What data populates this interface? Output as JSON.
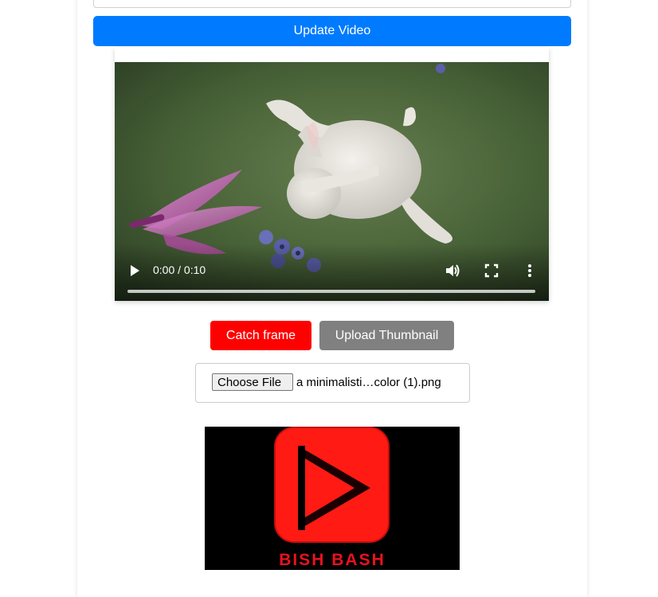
{
  "header": {
    "update_label": "Update Video"
  },
  "video": {
    "time_display": "0:00 / 0:10",
    "progress": 0.0
  },
  "actions": {
    "catch_label": "Catch frame",
    "upload_label": "Upload Thumbnail"
  },
  "file_input": {
    "button_label": "Choose File",
    "file_name": "a minimalisti…color (1).png"
  },
  "thumbnail": {
    "brand_text": "BISH BASH"
  },
  "icons": {
    "play": "play-icon",
    "volume": "volume-icon",
    "fullscreen": "fullscreen-icon",
    "more": "more-vertical-icon",
    "logo": "play-logo-icon"
  },
  "colors": {
    "primary": "#007bff",
    "catch": "#ff0000",
    "upload": "#808080",
    "brand_red": "#e8121e"
  }
}
